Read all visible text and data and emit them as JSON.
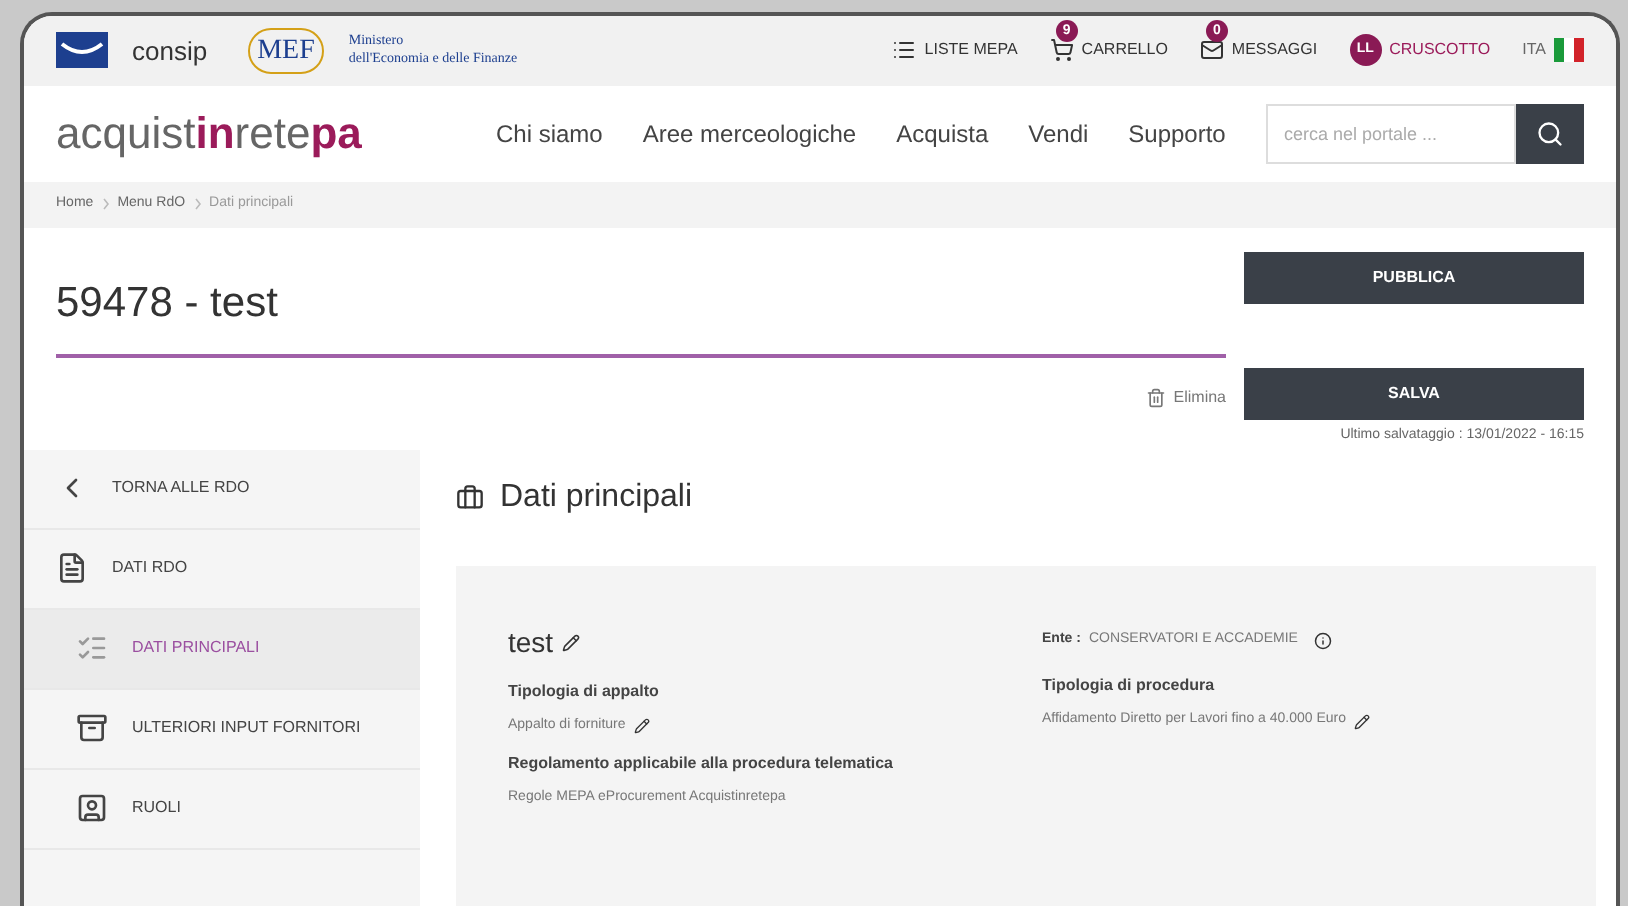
{
  "top_bar": {
    "brand": "consip",
    "ministry_logo": "MEF",
    "ministry_name": [
      "Ministero",
      "dell'Economia e delle Finanze"
    ],
    "links": [
      {
        "label": "LISTE MEPA",
        "kind": "list"
      },
      {
        "label": "CARRELLO",
        "kind": "cart",
        "badge": "9"
      },
      {
        "label": "MESSAGGI",
        "kind": "mail",
        "badge": "0"
      },
      {
        "label": "CRUSCOTTO",
        "kind": "user",
        "avatar": "LL"
      }
    ],
    "language": "ITA"
  },
  "nav": {
    "logo": [
      {
        "text": "acquist",
        "accent": false
      },
      {
        "text": "in",
        "accent": true
      },
      {
        "text": "rete",
        "accent": false
      },
      {
        "text": "pa",
        "accent": true
      }
    ],
    "items": [
      "Chi siamo",
      "Aree merceologiche",
      "Acquista",
      "Vendi",
      "Supporto"
    ],
    "search": {
      "placeholder": "cerca nel portale ..."
    }
  },
  "breadcrumb": [
    "Home",
    "Menu RdO",
    "Dati principali"
  ],
  "header": {
    "title": "59478 - test",
    "delete": "Elimina",
    "publish": "PUBBLICA",
    "save": "SALVA",
    "last_saved": "Ultimo salvataggio :  13/01/2022 - 16:15"
  },
  "sidebar": {
    "items": [
      {
        "label": "TORNA ALLE RDO",
        "kind": "back",
        "selected": false
      },
      {
        "label": "DATI RDO",
        "kind": "doc",
        "selected": false
      },
      {
        "label": "DATI PRINCIPALI",
        "kind": "list",
        "selected": true
      },
      {
        "label": "ULTERIORI INPUT FORNITORI",
        "kind": "box",
        "selected": false
      },
      {
        "label": "RUOLI",
        "kind": "person",
        "selected": false
      }
    ]
  },
  "main": {
    "heading": "Dati principali",
    "card": {
      "name": "test",
      "ente_label": "Ente :",
      "ente_value": "CONSERVATORI E ACCADEMIE",
      "left": [
        {
          "label": "Tipologia di appalto",
          "value": "Appalto di forniture",
          "editable": true
        },
        {
          "label": "Regolamento applicabile alla procedura telematica",
          "value": "Regole MEPA eProcurement Acquistinretepa",
          "editable": false
        }
      ],
      "right": [
        {
          "label": "Tipologia di procedura",
          "value": "Affidamento Diretto per Lavori fino a 40.000 Euro",
          "editable": true
        }
      ]
    }
  }
}
